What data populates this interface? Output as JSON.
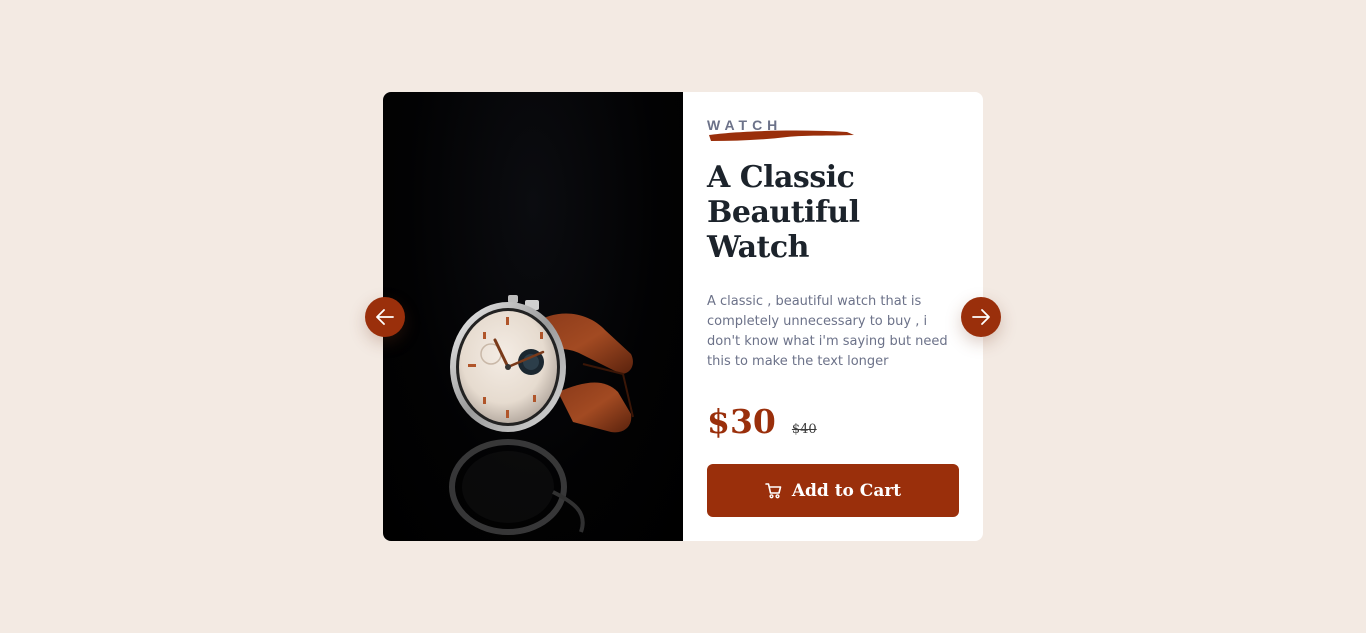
{
  "product": {
    "category": "WATCH",
    "title": "A Classic Beautiful Watch",
    "description": "A classic , beautiful watch that is completely unnecessary to buy , i don't know what i'm saying but need this to make the text longer",
    "price": "$30",
    "old_price": "$40",
    "image_alt": "Wrist watch with brown leather strap on black background"
  },
  "actions": {
    "add_to_cart_label": "Add to Cart",
    "cart_icon": "cart-icon",
    "prev_icon": "arrow-left-icon",
    "next_icon": "arrow-right-icon"
  },
  "colors": {
    "background": "#f3eae3",
    "accent": "#9a2f0b",
    "heading": "#1c232b",
    "muted": "#6c7289",
    "card": "#ffffff"
  }
}
